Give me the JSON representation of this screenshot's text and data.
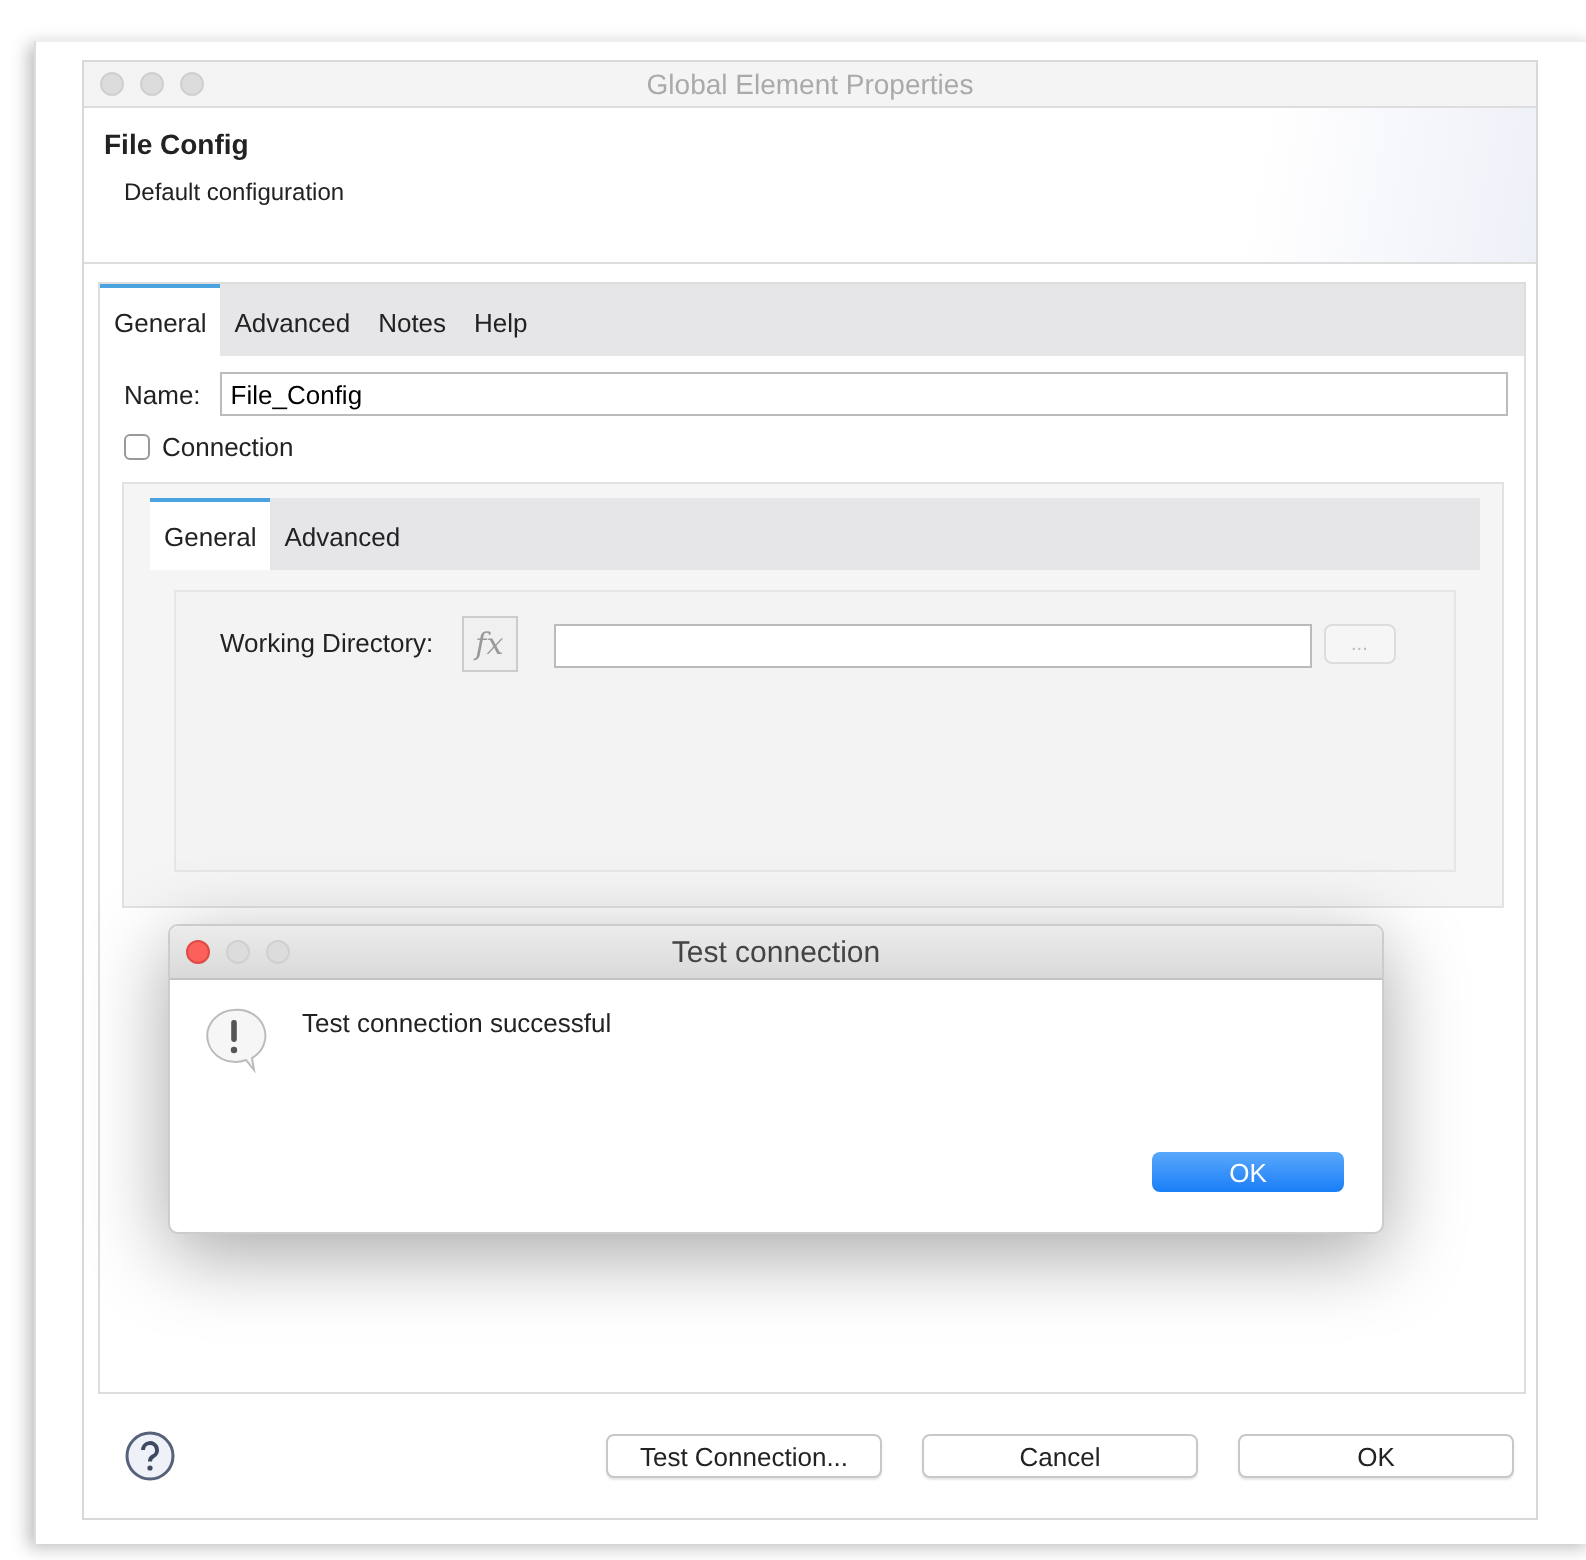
{
  "window": {
    "title": "Global Element Properties"
  },
  "header": {
    "title": "File Config",
    "subtitle": "Default configuration"
  },
  "tabs": [
    {
      "label": "General",
      "selected": true
    },
    {
      "label": "Advanced",
      "selected": false
    },
    {
      "label": "Notes",
      "selected": false
    },
    {
      "label": "Help",
      "selected": false
    }
  ],
  "name_field": {
    "label": "Name:",
    "value": "File_Config"
  },
  "connection": {
    "label": "Connection",
    "checked": false
  },
  "inner_tabs": [
    {
      "label": "General",
      "selected": true
    },
    {
      "label": "Advanced",
      "selected": false
    }
  ],
  "working_directory": {
    "label": "Working Directory:",
    "fx": "fx",
    "browse": "..."
  },
  "buttons": [
    {
      "label": "Test Connection..."
    },
    {
      "label": "Cancel"
    },
    {
      "label": "OK"
    }
  ],
  "alert": {
    "title": "Test connection",
    "message": "Test connection successful",
    "button": "OK"
  }
}
